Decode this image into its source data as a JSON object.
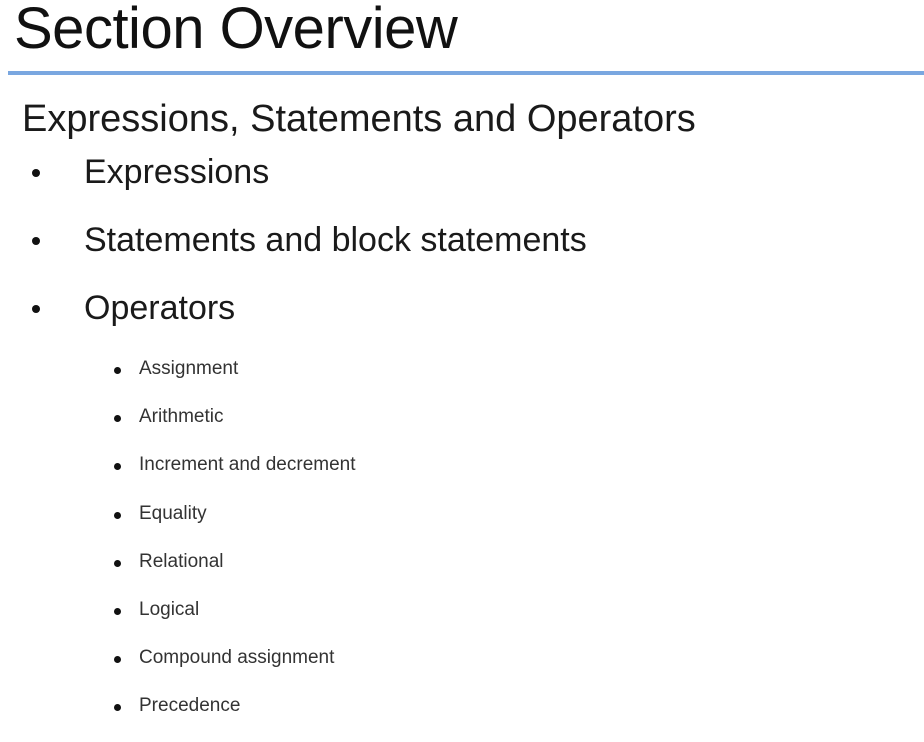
{
  "title": "Section Overview",
  "subtitle": "Expressions, Statements and Operators",
  "accent_color": "#7aa7e0",
  "bullets": [
    "Expressions",
    "Statements and block statements",
    "Operators"
  ],
  "sub_bullets": [
    "Assignment",
    "Arithmetic",
    "Increment and decrement",
    "Equality",
    "Relational",
    "Logical",
    "Compound assignment",
    "Precedence"
  ]
}
